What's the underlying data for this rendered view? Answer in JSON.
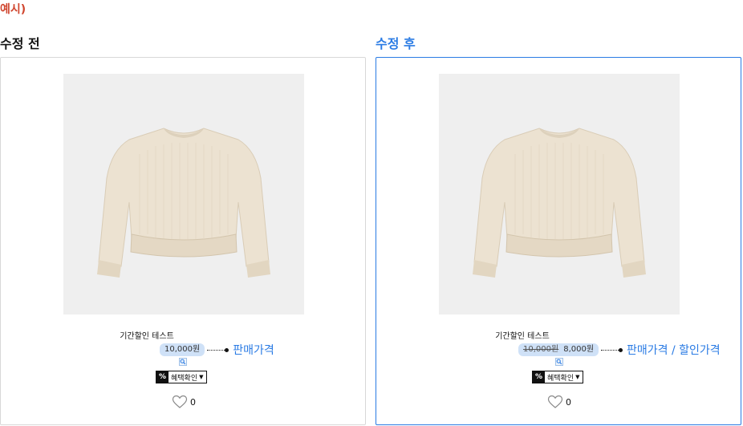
{
  "example_label": "예시)",
  "before": {
    "title": "수정 전",
    "product_name": "기간할인 테스트",
    "price": "10,000원",
    "callout": "판매가격",
    "benefit_label": "혜택확인",
    "benefit_badge": "%",
    "like_count": "0"
  },
  "after": {
    "title": "수정 후",
    "product_name": "기간할인 테스트",
    "original_price": "10,000원",
    "sale_price": "8,000원",
    "callout": "판매가격 / 할인가격",
    "benefit_label": "혜택확인",
    "benefit_badge": "%",
    "like_count": "0"
  },
  "colors": {
    "accent": "#2a7be4",
    "example_label": "#d0462f",
    "price_pill": "#cfe1f7",
    "image_bg": "#efefef"
  },
  "icons": [
    "sweater-image",
    "zoom-icon",
    "caret-down-icon",
    "heart-icon"
  ]
}
